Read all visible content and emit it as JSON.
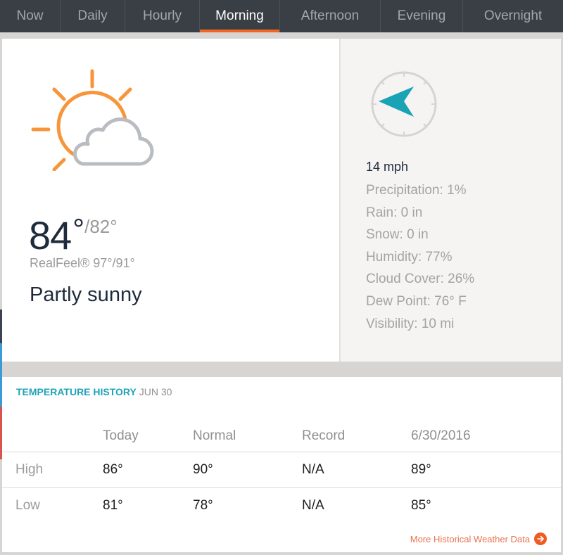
{
  "tabs": [
    {
      "label": "Now",
      "active": false
    },
    {
      "label": "Daily",
      "active": false
    },
    {
      "label": "Hourly",
      "active": false
    },
    {
      "label": "Morning",
      "active": true
    },
    {
      "label": "Afternoon",
      "active": false
    },
    {
      "label": "Evening",
      "active": false
    },
    {
      "label": "Overnight",
      "active": false
    }
  ],
  "current": {
    "icon": "partly-sunny-icon",
    "temperature": "84",
    "degree_symbol": "°",
    "low": "/82°",
    "realfeel": "RealFeel® 97°/91°",
    "phrase": "Partly sunny",
    "wind": {
      "direction_icon": "compass-arrow-west-icon",
      "speed": "14 mph"
    },
    "stats": [
      "Precipitation: 1%",
      "Rain: 0 in",
      "Snow: 0 in",
      "Humidity: 77%",
      "Cloud Cover: 26%",
      "Dew Point: 76° F",
      "Visibility: 10 mi"
    ]
  },
  "history": {
    "title": "TEMPERATURE HISTORY",
    "date": "JUN 30",
    "columns": [
      "Today",
      "Normal",
      "Record",
      "6/30/2016"
    ],
    "rows": [
      {
        "label": "High",
        "values": [
          "86°",
          "90°",
          "N/A",
          "89°"
        ]
      },
      {
        "label": "Low",
        "values": [
          "81°",
          "78°",
          "N/A",
          "85°"
        ]
      }
    ],
    "more_link": "More Historical Weather Data"
  },
  "colors": {
    "accent_orange": "#f26522",
    "accent_teal": "#1fa3b8",
    "tab_bar": "#3a3f45",
    "sun": "#f7953a",
    "cloud": "#b9bcc0"
  }
}
